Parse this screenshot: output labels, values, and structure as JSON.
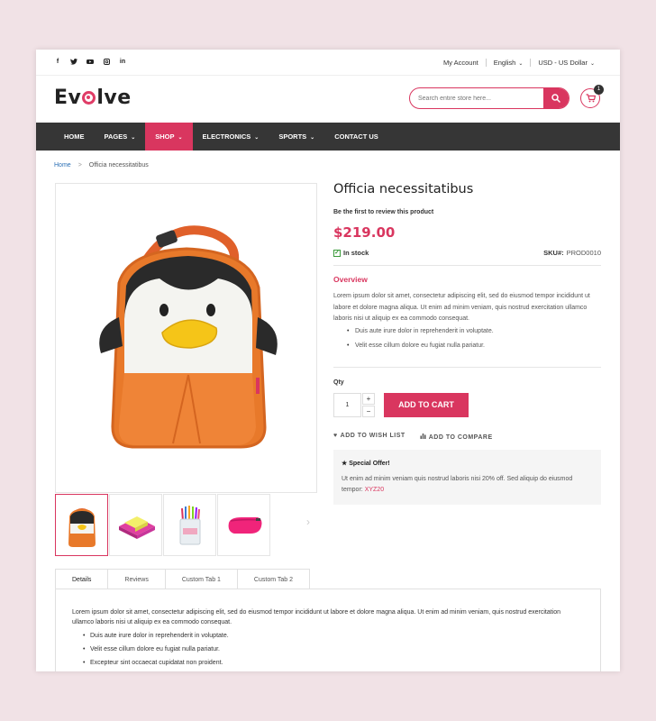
{
  "topbar": {
    "socials": [
      "f",
      "t",
      "yt",
      "ig",
      "in"
    ],
    "my_account": "My Account",
    "language": "English",
    "currency": "USD - US Dollar"
  },
  "header": {
    "logo_text_start": "Ev",
    "logo_text_end": "lve",
    "search_placeholder": "Search entire store here...",
    "cart_count": "1"
  },
  "nav": {
    "items": [
      "HOME",
      "PAGES",
      "SHOP",
      "ELECTRONICS",
      "SPORTS",
      "CONTACT US"
    ]
  },
  "breadcrumb": {
    "home": "Home",
    "separator": ">",
    "current": "Officia necessitatibus"
  },
  "product": {
    "title": "Officia necessitatibus",
    "review_link": "Be the first to review this product",
    "price": "$219.00",
    "stock": "In stock",
    "sku_label": "SKU#:",
    "sku_value": "PROD0010",
    "overview_title": "Overview",
    "overview_text": "Lorem ipsum dolor sit amet, consectetur adipiscing elit, sed do eiusmod tempor incididunt ut labore et dolore magna aliqua. Ut enim ad minim veniam, quis nostrud exercitation ullamco laboris nisi ut aliquip ex ea commodo consequat.",
    "overview_bullets": [
      "Duis aute irure dolor in reprehenderit in voluptate.",
      "Velit esse cillum dolore eu fugiat nulla pariatur."
    ],
    "qty_label": "Qty",
    "qty_value": "1",
    "qty_up": "+",
    "qty_down": "−",
    "add_to_cart": "ADD TO CART",
    "wishlist": "ADD TO WISH LIST",
    "compare": "ADD TO COMPARE",
    "offer_title": "Special Offer!",
    "offer_text": "Ut enim ad minim veniam quis nostrud laboris nisi 20% off. Sed aliquip do eiusmod tempor: ",
    "offer_code": "XYZ20"
  },
  "tabs": {
    "labels": [
      "Details",
      "Reviews",
      "Custom Tab 1",
      "Custom Tab 2"
    ],
    "details_text": "Lorem ipsum dolor sit amet, consectetur adipiscing elit, sed do eiusmod tempor incididunt ut labore et dolore magna aliqua. Ut enim ad minim veniam, quis nostrud exercitation ullamco laboris nisi ut aliquip ex ea commodo consequat.",
    "details_bullets": [
      "Duis aute irure dolor in reprehenderit in voluptate.",
      "Velit esse cillum dolore eu fugiat nulla pariatur.",
      "Excepteur sint occaecat cupidatat non proident."
    ]
  },
  "colors": {
    "accent": "#d9365f",
    "nav_bg": "#363636",
    "page_bg": "#f1e2e6"
  },
  "icons": [
    "facebook-icon",
    "twitter-icon",
    "youtube-icon",
    "instagram-icon",
    "linkedin-icon",
    "search-icon",
    "cart-icon",
    "check-icon",
    "heart-icon",
    "bar-chart-icon",
    "star-icon",
    "chevron-right-icon"
  ]
}
